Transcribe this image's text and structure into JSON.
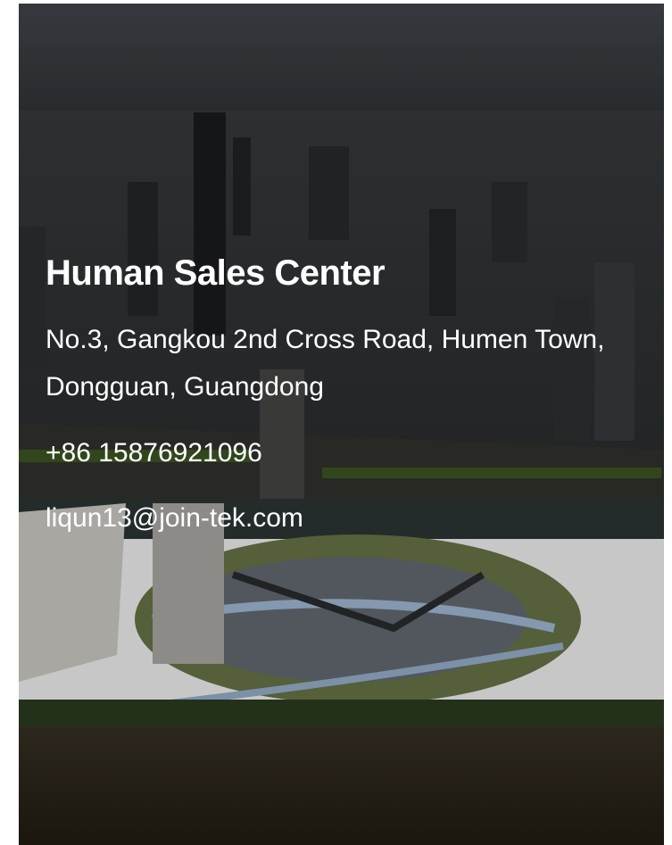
{
  "contact_card": {
    "title": "Human Sales Center",
    "address": "No.3, Gangkou 2nd Cross Road, Humen Town, Dongguan, Guangdong",
    "phone": "+86 15876921096",
    "email": "liqun13@join-tek.com"
  },
  "background": {
    "icon": "city-aerial-photo",
    "colors": {
      "sky": "#3b3f44",
      "city": "#2d2f31",
      "river": "#2c2518",
      "greenery": "#4a6b2a",
      "text": "#ffffff"
    }
  }
}
